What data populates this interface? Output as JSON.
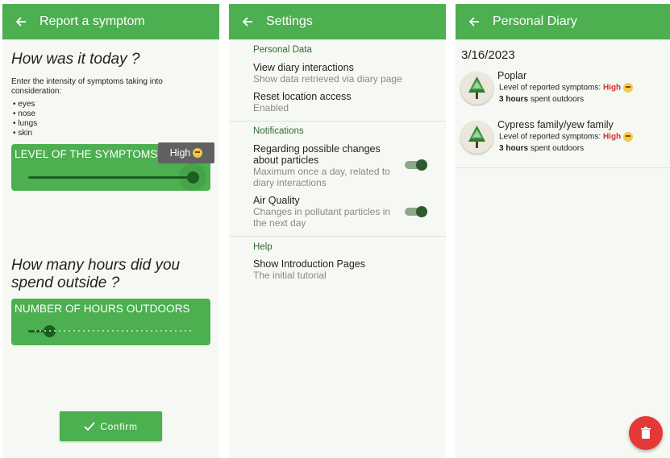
{
  "symptom": {
    "title": "Report a symptom",
    "question1": "How was it today ?",
    "description": "Enter the intensity of symptoms taking into consideration:",
    "body_parts": [
      "eyes",
      "nose",
      "lungs",
      "skin"
    ],
    "level_label": "LEVEL OF THE SYMPTOMS",
    "level_tooltip": "High",
    "level_value": 0.95,
    "question2": "How many hours did you spend outside ?",
    "hours_label": "NUMBER OF HOURS OUTDOORS",
    "hours_value": 0.12,
    "confirm_label": "Confirm"
  },
  "settings": {
    "title": "Settings",
    "sections": [
      {
        "header": "Personal Data",
        "items": [
          {
            "title": "View diary interactions",
            "subtitle": "Show data retrieved via diary page"
          },
          {
            "title": "Reset location access",
            "subtitle": "Enabled"
          }
        ]
      },
      {
        "header": "Notifications",
        "items": [
          {
            "title": "Regarding possible changes about particles",
            "subtitle": "Maximum once a day, related to diary interactions",
            "toggle": true
          },
          {
            "title": "Air Quality",
            "subtitle": "Changes in pollutant particles in the next day",
            "toggle": true
          }
        ]
      },
      {
        "header": "Help",
        "items": [
          {
            "title": "Show Introduction Pages",
            "subtitle": "The initial tutorial"
          }
        ]
      }
    ]
  },
  "diary": {
    "title": "Personal Diary",
    "date": "3/16/2023",
    "entries": [
      {
        "name": "Poplar",
        "level_prefix": "Level of reported symptoms:",
        "level": "High",
        "hours": "3 hours",
        "hours_suffix": "spent outdoors"
      },
      {
        "name": "Cypress family/yew family",
        "level_prefix": "Level of reported symptoms:",
        "level": "High",
        "hours": "3 hours",
        "hours_suffix": "spent outdoors"
      }
    ]
  },
  "colors": {
    "primary": "#4caf50",
    "dark": "#1b5e20",
    "accent_red": "#e53935",
    "high": "#d32f2f"
  },
  "icons": [
    "back-arrow-icon",
    "check-icon",
    "emoji-icon",
    "tree-icon",
    "trash-icon"
  ]
}
